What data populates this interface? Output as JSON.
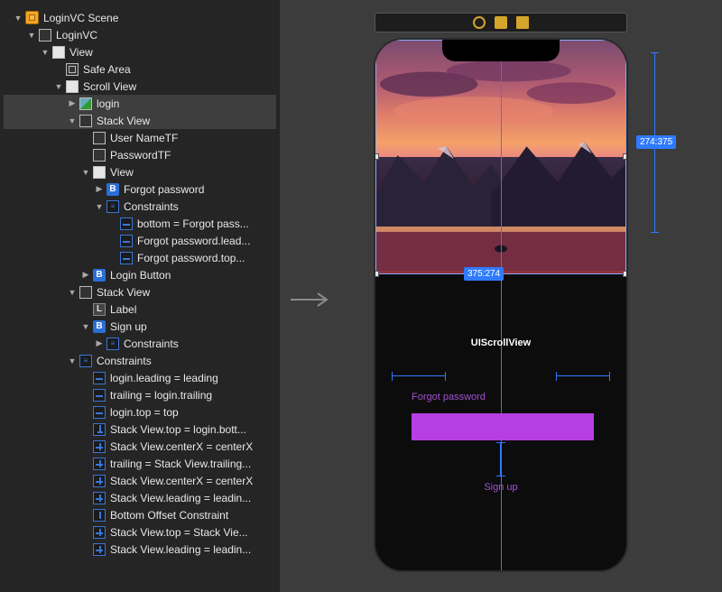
{
  "outline": {
    "root": "LoginVC Scene",
    "items": [
      {
        "depth": 0,
        "disc": "open",
        "icon": "scene",
        "label": "LoginVC Scene"
      },
      {
        "depth": 1,
        "disc": "open",
        "icon": "view",
        "label": "LoginVC"
      },
      {
        "depth": 2,
        "disc": "open",
        "icon": "viewfill",
        "label": "View"
      },
      {
        "depth": 3,
        "disc": "none",
        "icon": "safe",
        "label": "Safe Area"
      },
      {
        "depth": 3,
        "disc": "open",
        "icon": "viewfill",
        "label": "Scroll View"
      },
      {
        "depth": 4,
        "disc": "closed",
        "icon": "img",
        "label": "login",
        "sel": true
      },
      {
        "depth": 4,
        "disc": "open",
        "icon": "stack",
        "label": "Stack View",
        "sel": true
      },
      {
        "depth": 5,
        "disc": "none",
        "icon": "view",
        "label": "User NameTF"
      },
      {
        "depth": 5,
        "disc": "none",
        "icon": "view",
        "label": "PasswordTF"
      },
      {
        "depth": 5,
        "disc": "open",
        "icon": "viewfill",
        "label": "View"
      },
      {
        "depth": 6,
        "disc": "closed",
        "icon": "b",
        "label": "Forgot password"
      },
      {
        "depth": 6,
        "disc": "open",
        "icon": "congrp",
        "label": "Constraints"
      },
      {
        "depth": 7,
        "disc": "none",
        "icon": "con-h",
        "label": "bottom = Forgot pass..."
      },
      {
        "depth": 7,
        "disc": "none",
        "icon": "con-h",
        "label": "Forgot password.lead..."
      },
      {
        "depth": 7,
        "disc": "none",
        "icon": "con-h",
        "label": "Forgot password.top..."
      },
      {
        "depth": 5,
        "disc": "closed",
        "icon": "b",
        "label": "Login Button"
      },
      {
        "depth": 4,
        "disc": "open",
        "icon": "hstack",
        "label": "Stack View"
      },
      {
        "depth": 5,
        "disc": "none",
        "icon": "l",
        "label": "Label"
      },
      {
        "depth": 5,
        "disc": "open",
        "icon": "b",
        "label": "Sign up"
      },
      {
        "depth": 6,
        "disc": "closed",
        "icon": "congrp",
        "label": "Constraints"
      },
      {
        "depth": 4,
        "disc": "open",
        "icon": "congrp",
        "label": "Constraints"
      },
      {
        "depth": 5,
        "disc": "none",
        "icon": "con-h",
        "label": "login.leading = leading"
      },
      {
        "depth": 5,
        "disc": "none",
        "icon": "con-h",
        "label": "trailing = login.trailing"
      },
      {
        "depth": 5,
        "disc": "none",
        "icon": "con-h",
        "label": "login.top = top"
      },
      {
        "depth": 5,
        "disc": "none",
        "icon": "con-pin",
        "label": "Stack View.top = login.bott..."
      },
      {
        "depth": 5,
        "disc": "none",
        "icon": "con-hv",
        "label": "Stack View.centerX = centerX"
      },
      {
        "depth": 5,
        "disc": "none",
        "icon": "con-hv",
        "label": "trailing = Stack View.trailing..."
      },
      {
        "depth": 5,
        "disc": "none",
        "icon": "con-hv",
        "label": "Stack View.centerX = centerX"
      },
      {
        "depth": 5,
        "disc": "none",
        "icon": "con-hv",
        "label": "Stack View.leading = leadin..."
      },
      {
        "depth": 5,
        "disc": "none",
        "icon": "con-v",
        "label": "Bottom Offset Constraint"
      },
      {
        "depth": 5,
        "disc": "none",
        "icon": "con-hv",
        "label": "Stack View.top = Stack Vie..."
      },
      {
        "depth": 5,
        "disc": "none",
        "icon": "con-hv",
        "label": "Stack View.leading = leadin..."
      }
    ]
  },
  "canvas": {
    "uiscrollview_label": "UIScrollView",
    "forgot_label": "Forgot password",
    "signup_label": "Sign up",
    "dim_right": "274:375",
    "dim_bottom": "375:274"
  }
}
